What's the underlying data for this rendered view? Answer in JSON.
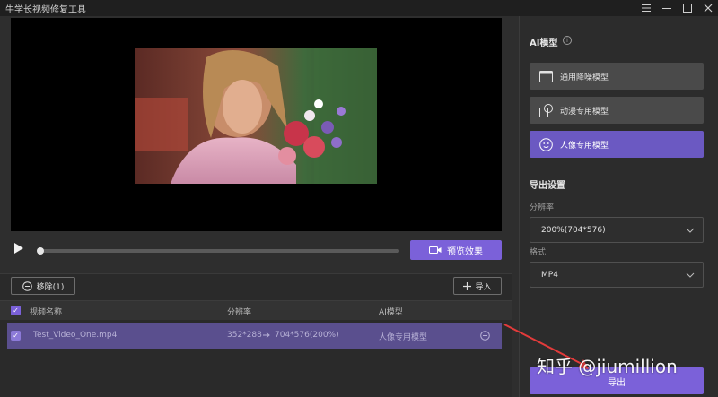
{
  "window": {
    "title": "牛学长视频修复工具",
    "controls": [
      "menu-icon",
      "minimize-icon",
      "maximize-icon",
      "close-icon"
    ]
  },
  "player": {
    "preview_label": "预览效果",
    "progress": 0.0
  },
  "list": {
    "remove_label": "移除(1)",
    "import_label": "导入",
    "columns": [
      "视频名称",
      "分辨率",
      "AI模型"
    ],
    "rows": [
      {
        "name": "Test_Video_One.mp4",
        "src_res": "352*288",
        "dst_res": "704*576(200%)",
        "model": "人像专用模型",
        "checked": true
      }
    ]
  },
  "sidebar": {
    "ai_title": "AI模型",
    "models": [
      {
        "label": "通用降噪模型",
        "icon": "film-icon",
        "active": false
      },
      {
        "label": "动漫专用模型",
        "icon": "shapes-icon",
        "active": false
      },
      {
        "label": "人像专用模型",
        "icon": "face-icon",
        "active": true
      }
    ],
    "export_title": "导出设置",
    "resolution_label": "分辨率",
    "resolution_value": "200%(704*576)",
    "format_label": "格式",
    "format_value": "MP4",
    "export_label": "导出"
  },
  "watermark": "知乎 @jiumillion",
  "colors": {
    "accent": "#7b61d9",
    "active_model": "#6b59c2",
    "selected_row": "#5a4f8e"
  }
}
